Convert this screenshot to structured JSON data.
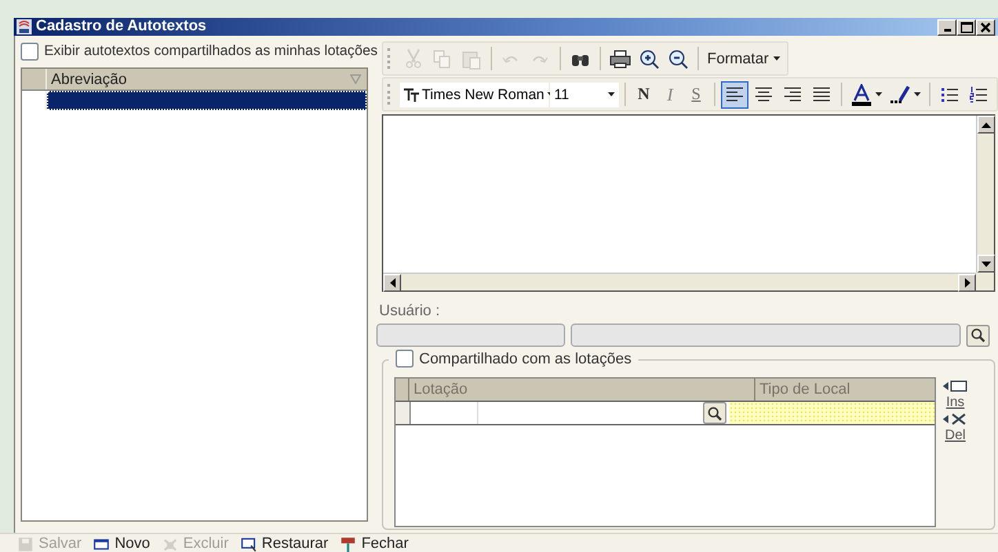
{
  "window": {
    "title": "Cadastro de Autotextos"
  },
  "left_panel": {
    "show_shared": {
      "label": "Exibir autotextos compartilhados as minhas lotações",
      "checked": false
    },
    "table": {
      "columns": [
        "Abreviação"
      ],
      "rows": [
        {
          "selected": true
        }
      ]
    }
  },
  "toolbar_1": [
    {
      "kind": "cut",
      "disabled": true
    },
    {
      "kind": "copy",
      "disabled": true
    },
    {
      "kind": "paste",
      "disabled": true
    },
    {
      "kind": "sep"
    },
    {
      "kind": "undo",
      "disabled": true
    },
    {
      "kind": "redo",
      "disabled": true
    },
    {
      "kind": "sep"
    },
    {
      "kind": "find",
      "disabled": false
    },
    {
      "kind": "sep"
    },
    {
      "kind": "print",
      "disabled": false
    },
    {
      "kind": "zoom-in",
      "disabled": false
    },
    {
      "kind": "zoom-out",
      "disabled": false
    },
    {
      "kind": "sep"
    },
    {
      "kind": "menu",
      "label": "Formatar"
    }
  ],
  "toolbar_2": {
    "font": "Times New Roman",
    "size": "11",
    "buttons": [
      {
        "kind": "bold",
        "label": "N",
        "selected": false
      },
      {
        "kind": "italic",
        "label": "I",
        "selected": false
      },
      {
        "kind": "underline",
        "label": "S",
        "selected": false
      },
      {
        "kind": "sep"
      },
      {
        "kind": "align-left",
        "selected": true
      },
      {
        "kind": "align-center",
        "selected": false
      },
      {
        "kind": "align-right",
        "selected": false
      },
      {
        "kind": "justify",
        "selected": false
      },
      {
        "kind": "sep"
      },
      {
        "kind": "font-color"
      },
      {
        "kind": "highlight"
      },
      {
        "kind": "sep"
      },
      {
        "kind": "bullets"
      },
      {
        "kind": "numbering"
      }
    ]
  },
  "user": {
    "label": "Usuário :",
    "disabled": true
  },
  "sharing": {
    "label": "Compartilhado com as lotações",
    "checked": false,
    "columns": [
      "Lotação",
      "Tipo de Local"
    ],
    "actions": [
      "Ins",
      "Del"
    ]
  },
  "footer": [
    {
      "kind": "save",
      "label": "Salvar",
      "disabled": true
    },
    {
      "kind": "new",
      "label": "Novo",
      "disabled": false
    },
    {
      "kind": "delete",
      "label": "Excluir",
      "disabled": true
    },
    {
      "kind": "restore",
      "label": "Restaurar",
      "disabled": false
    },
    {
      "kind": "close",
      "label": "Fechar",
      "disabled": false
    }
  ]
}
